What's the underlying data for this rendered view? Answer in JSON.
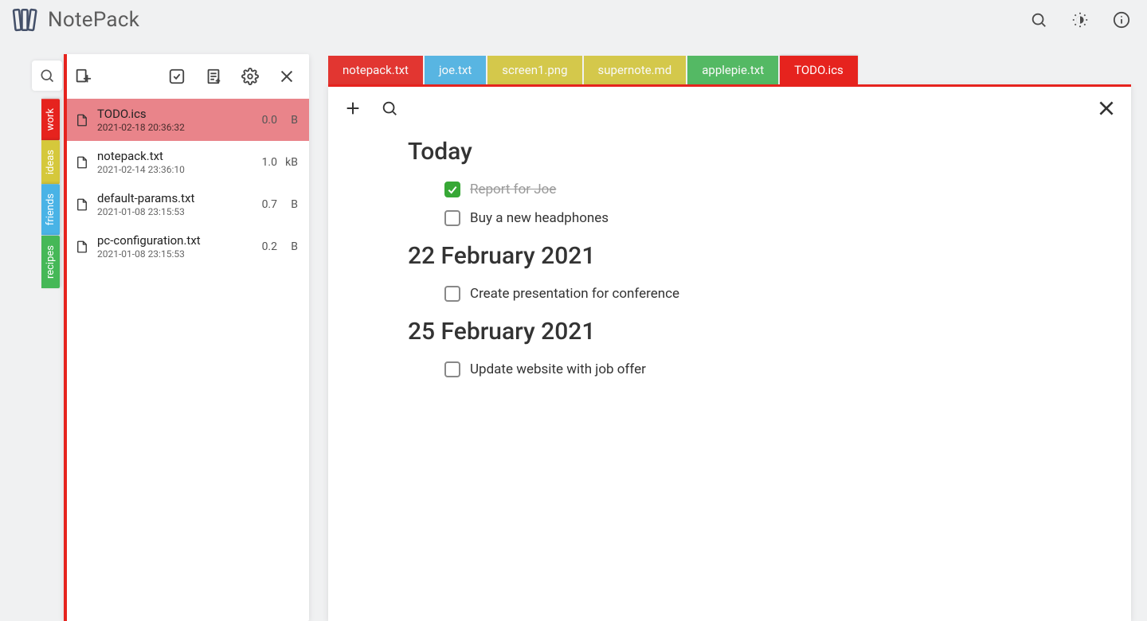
{
  "app": {
    "title": "NotePack"
  },
  "colors": {
    "accent": "#e6231e",
    "selected_file_bg": "#e9848a",
    "check_done": "#37a836"
  },
  "categories": [
    {
      "label": "work",
      "color": "#e6231e"
    },
    {
      "label": "ideas",
      "color": "#d5c83b"
    },
    {
      "label": "friends",
      "color": "#49b3e6"
    },
    {
      "label": "recipes",
      "color": "#45b857"
    }
  ],
  "sidebar": {
    "files": [
      {
        "name": "TODO.ics",
        "date": "2021-02-18 20:36:32",
        "size_num": "0.0",
        "size_unit": "B",
        "selected": true
      },
      {
        "name": "notepack.txt",
        "date": "2021-02-14 23:36:10",
        "size_num": "1.0",
        "size_unit": "kB",
        "selected": false
      },
      {
        "name": "default-params.txt",
        "date": "2021-01-08 23:15:53",
        "size_num": "0.7",
        "size_unit": "B",
        "selected": false
      },
      {
        "name": "pc-configuration.txt",
        "date": "2021-01-08 23:15:53",
        "size_num": "0.2",
        "size_unit": "B",
        "selected": false
      }
    ]
  },
  "tabs": [
    {
      "label": "notepack.txt",
      "color": "#e6231e",
      "active": false
    },
    {
      "label": "joe.txt",
      "color": "#49b3e6",
      "active": false
    },
    {
      "label": "screen1.png",
      "color": "#d5c83b",
      "active": false
    },
    {
      "label": "supernote.md",
      "color": "#d5c83b",
      "active": false
    },
    {
      "label": "applepie.txt",
      "color": "#45b857",
      "active": false
    },
    {
      "label": "TODO.ics",
      "color": "#e6231e",
      "active": true
    }
  ],
  "todo": {
    "sections": [
      {
        "title": "Today",
        "items": [
          {
            "text": "Report for Joe",
            "done": true
          },
          {
            "text": "Buy a new headphones",
            "done": false
          }
        ]
      },
      {
        "title": "22 February 2021",
        "items": [
          {
            "text": "Create presentation for conference",
            "done": false
          }
        ]
      },
      {
        "title": "25 February 2021",
        "items": [
          {
            "text": "Update website with job offer",
            "done": false
          }
        ]
      }
    ]
  }
}
